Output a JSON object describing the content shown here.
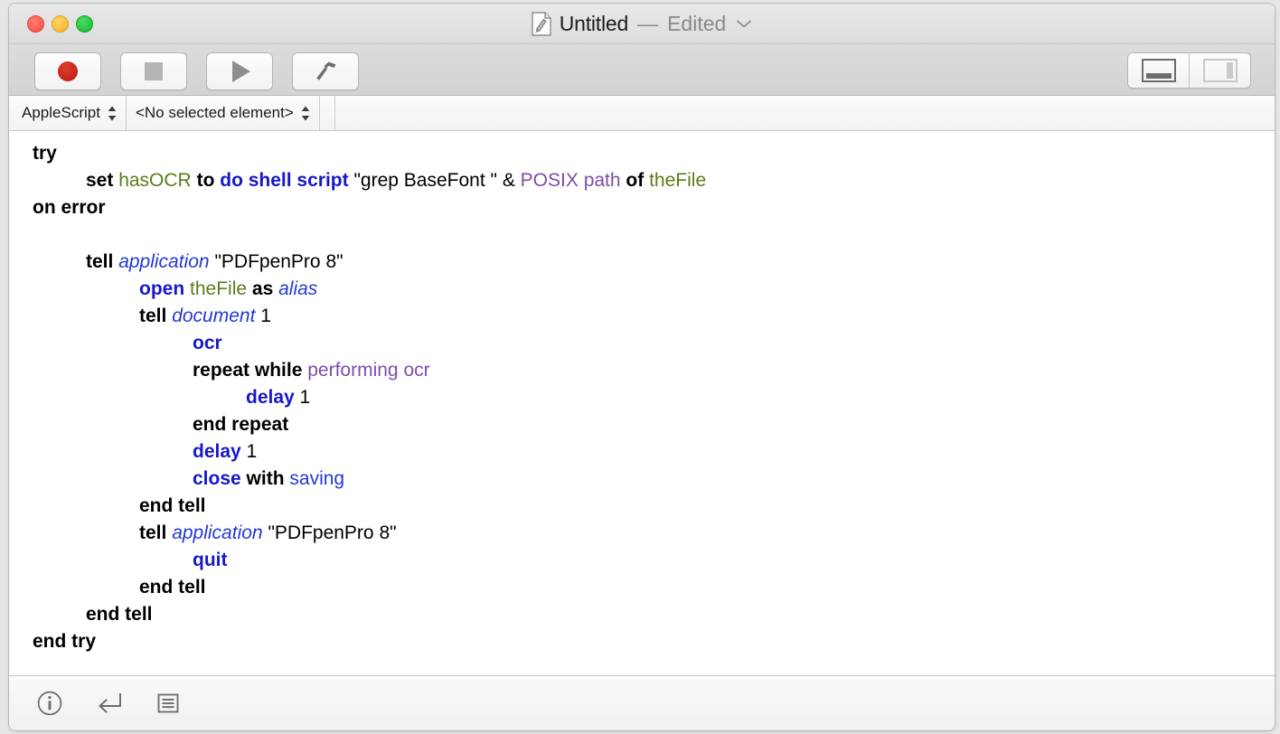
{
  "window": {
    "title": "Untitled",
    "dash": "—",
    "edited_label": "Edited",
    "doc_icon": "script-document-icon",
    "chevron_icon": "chevron-down-icon",
    "traffic_lights": [
      {
        "name": "close-button",
        "label": "Close",
        "color": "#fb5f57"
      },
      {
        "name": "minimize-button",
        "label": "Minimize",
        "color": "#fdbc40"
      },
      {
        "name": "zoom-button",
        "label": "Zoom",
        "color": "#2bc840"
      }
    ]
  },
  "toolbar": {
    "buttons": [
      {
        "name": "record-button",
        "label": "Record",
        "icon": "record-circle-icon",
        "color": "#c8241c"
      },
      {
        "name": "stop-button",
        "label": "Stop",
        "icon": "stop-square-icon",
        "color": "#b4b4b4"
      },
      {
        "name": "run-button",
        "label": "Run",
        "icon": "play-triangle-icon",
        "color": "#8e8e8e"
      },
      {
        "name": "compile-button",
        "label": "Compile",
        "icon": "hammer-icon",
        "color": "#6f6f6f"
      }
    ],
    "view_segments": [
      {
        "name": "bottom-pane-toggle",
        "label": "Show Bottom Pane",
        "icon": "bottom-pane-icon",
        "active": true
      },
      {
        "name": "right-pane-toggle",
        "label": "Show Right Pane",
        "icon": "right-pane-icon",
        "active": false
      }
    ]
  },
  "navbar": {
    "language_popup": {
      "label": "AppleScript",
      "icon": "updown-chevrons-icon"
    },
    "element_popup": {
      "label": "<No selected element>",
      "icon": "updown-chevrons-icon"
    }
  },
  "bottombar": {
    "icons": [
      {
        "name": "description-info-icon",
        "label": "Description"
      },
      {
        "name": "result-return-icon",
        "label": "Result"
      },
      {
        "name": "log-list-icon",
        "label": "Log"
      }
    ]
  },
  "editor": {
    "language": "AppleScript",
    "lines": [
      {
        "indent": 0,
        "tokens": [
          {
            "t": "try",
            "c": "kw"
          }
        ]
      },
      {
        "indent": 1,
        "tokens": [
          {
            "t": "set",
            "c": "kw"
          },
          {
            "t": " ",
            "c": "plain"
          },
          {
            "t": "hasOCR",
            "c": "var"
          },
          {
            "t": " ",
            "c": "plain"
          },
          {
            "t": "to",
            "c": "kw"
          },
          {
            "t": " ",
            "c": "plain"
          },
          {
            "t": "do shell script",
            "c": "cmd"
          },
          {
            "t": " ",
            "c": "plain"
          },
          {
            "t": "\"grep BaseFont \"",
            "c": "str"
          },
          {
            "t": " ",
            "c": "plain"
          },
          {
            "t": "&",
            "c": "plain"
          },
          {
            "t": " ",
            "c": "plain"
          },
          {
            "t": "POSIX path",
            "c": "prop"
          },
          {
            "t": " ",
            "c": "plain"
          },
          {
            "t": "of",
            "c": "kw"
          },
          {
            "t": " ",
            "c": "plain"
          },
          {
            "t": "theFile",
            "c": "var"
          }
        ]
      },
      {
        "indent": 0,
        "tokens": [
          {
            "t": "on error",
            "c": "kw"
          }
        ]
      },
      {
        "indent": 0,
        "tokens": []
      },
      {
        "indent": 1,
        "tokens": [
          {
            "t": "tell",
            "c": "kw"
          },
          {
            "t": " ",
            "c": "plain"
          },
          {
            "t": "application",
            "c": "cls"
          },
          {
            "t": " ",
            "c": "plain"
          },
          {
            "t": "\"PDFpenPro 8\"",
            "c": "str"
          }
        ]
      },
      {
        "indent": 2,
        "tokens": [
          {
            "t": "open",
            "c": "cmd"
          },
          {
            "t": " ",
            "c": "plain"
          },
          {
            "t": "theFile",
            "c": "var"
          },
          {
            "t": " ",
            "c": "plain"
          },
          {
            "t": "as",
            "c": "kw"
          },
          {
            "t": " ",
            "c": "plain"
          },
          {
            "t": "alias",
            "c": "cls"
          }
        ]
      },
      {
        "indent": 2,
        "tokens": [
          {
            "t": "tell",
            "c": "kw"
          },
          {
            "t": " ",
            "c": "plain"
          },
          {
            "t": "document",
            "c": "cls"
          },
          {
            "t": " ",
            "c": "plain"
          },
          {
            "t": "1",
            "c": "num"
          }
        ]
      },
      {
        "indent": 3,
        "tokens": [
          {
            "t": "ocr",
            "c": "cmd"
          }
        ]
      },
      {
        "indent": 3,
        "tokens": [
          {
            "t": "repeat while",
            "c": "kw"
          },
          {
            "t": " ",
            "c": "plain"
          },
          {
            "t": "performing ocr",
            "c": "prop"
          }
        ]
      },
      {
        "indent": 4,
        "tokens": [
          {
            "t": "delay",
            "c": "cmd"
          },
          {
            "t": " ",
            "c": "plain"
          },
          {
            "t": "1",
            "c": "num"
          }
        ]
      },
      {
        "indent": 3,
        "tokens": [
          {
            "t": "end repeat",
            "c": "kw"
          }
        ]
      },
      {
        "indent": 3,
        "tokens": [
          {
            "t": "delay",
            "c": "cmd"
          },
          {
            "t": " ",
            "c": "plain"
          },
          {
            "t": "1",
            "c": "num"
          }
        ]
      },
      {
        "indent": 3,
        "tokens": [
          {
            "t": "close",
            "c": "cmd"
          },
          {
            "t": " ",
            "c": "plain"
          },
          {
            "t": "with",
            "c": "kw"
          },
          {
            "t": " ",
            "c": "plain"
          },
          {
            "t": "saving",
            "c": "param"
          }
        ]
      },
      {
        "indent": 2,
        "tokens": [
          {
            "t": "end tell",
            "c": "kw"
          }
        ]
      },
      {
        "indent": 2,
        "tokens": [
          {
            "t": "tell",
            "c": "kw"
          },
          {
            "t": " ",
            "c": "plain"
          },
          {
            "t": "application",
            "c": "cls"
          },
          {
            "t": " ",
            "c": "plain"
          },
          {
            "t": "\"PDFpenPro 8\"",
            "c": "str"
          }
        ]
      },
      {
        "indent": 3,
        "tokens": [
          {
            "t": "quit",
            "c": "cmd"
          }
        ]
      },
      {
        "indent": 2,
        "tokens": [
          {
            "t": "end tell",
            "c": "kw"
          }
        ]
      },
      {
        "indent": 1,
        "tokens": [
          {
            "t": "end tell",
            "c": "kw"
          }
        ]
      },
      {
        "indent": 0,
        "tokens": [
          {
            "t": "end try",
            "c": "kw"
          }
        ]
      }
    ]
  },
  "colors": {
    "keyword": "#000000",
    "command": "#1818c8",
    "class": "#2437d6",
    "variable": "#5b7d1a",
    "property": "#7b4ea8",
    "parameter": "#2437d6",
    "background": "#ffffff"
  }
}
